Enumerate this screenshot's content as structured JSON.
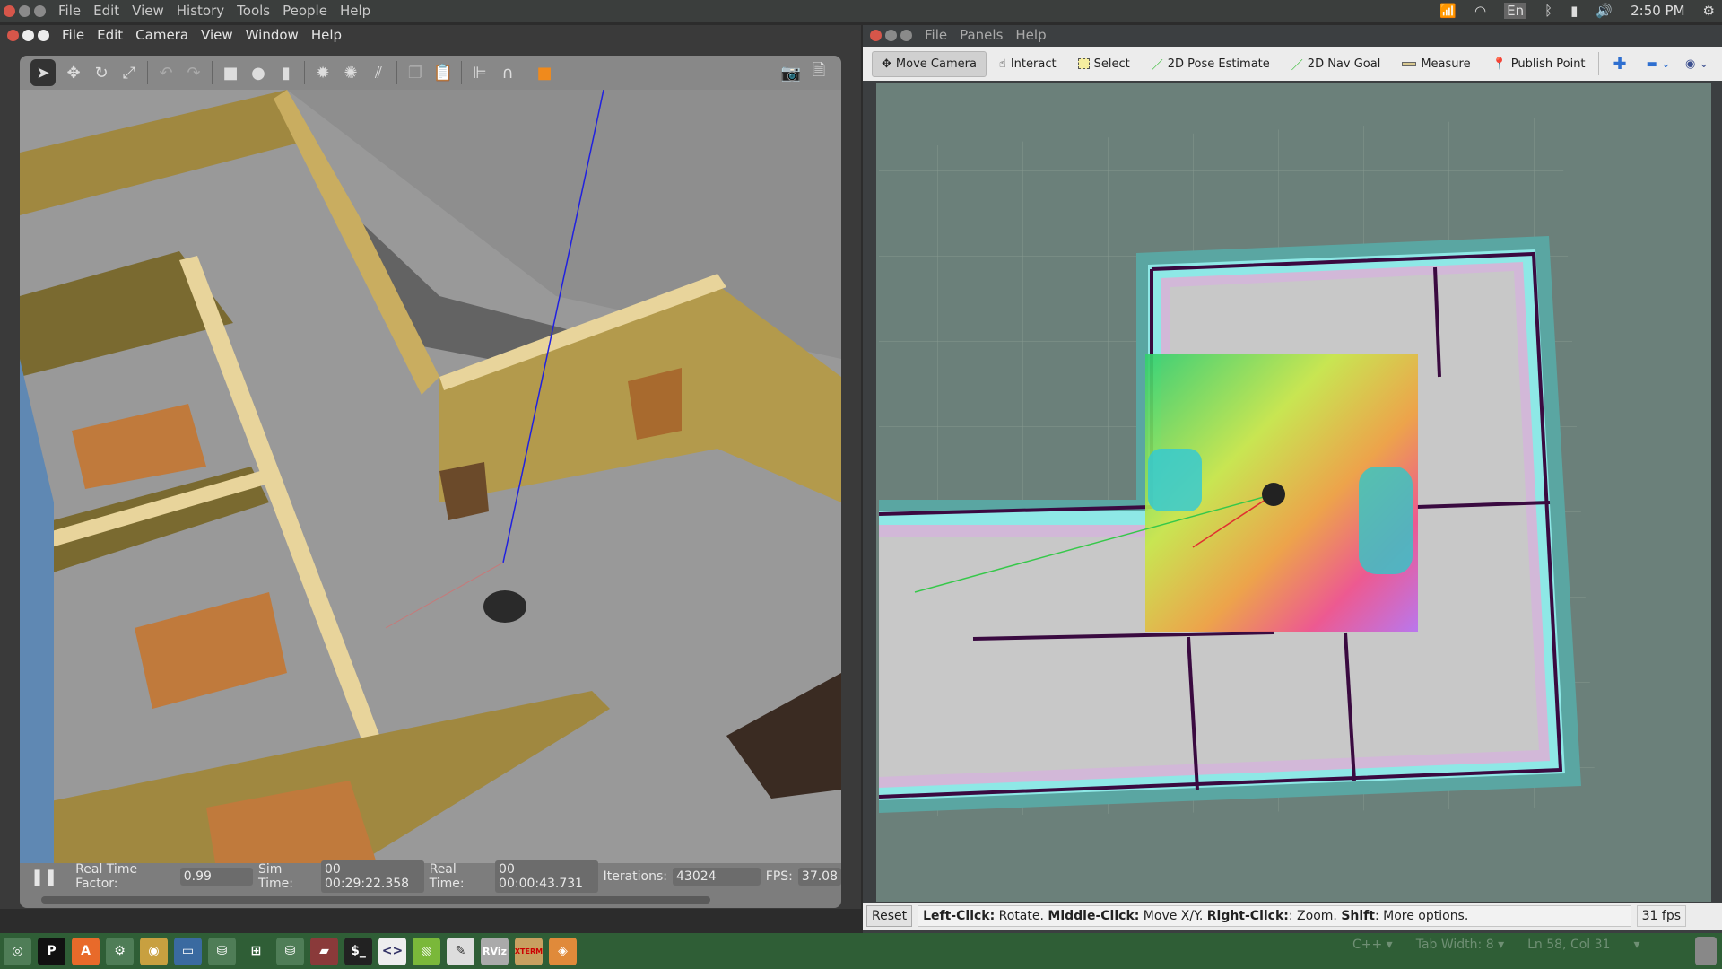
{
  "topbar": {
    "menus": [
      "File",
      "Edit",
      "View",
      "History",
      "Tools",
      "People",
      "Help"
    ],
    "keyboard": "En",
    "time": "2:50 PM"
  },
  "gazebo": {
    "menus": [
      "File",
      "Edit",
      "Camera",
      "View",
      "Window",
      "Help"
    ],
    "status": {
      "rtf_label": "Real Time Factor:",
      "rtf": "0.99",
      "sim_label": "Sim Time:",
      "sim": "00 00:29:22.358",
      "real_label": "Real Time:",
      "real": "00 00:00:43.731",
      "iter_label": "Iterations:",
      "iter": "43024",
      "fps_label": "FPS:",
      "fps": "37.08"
    }
  },
  "rviz": {
    "menus": [
      "File",
      "Panels",
      "Help"
    ],
    "tools": [
      "Move Camera",
      "Interact",
      "Select",
      "2D Pose Estimate",
      "2D Nav Goal",
      "Measure",
      "Publish Point"
    ],
    "reset": "Reset",
    "hint": {
      "b1": "Left-Click:",
      "t1": " Rotate. ",
      "b2": "Middle-Click:",
      "t2": " Move X/Y. ",
      "b3": "Right-Click:",
      "t3": ": Zoom. ",
      "b4": "Shift",
      "t4": ": More options."
    },
    "fps": "31 fps"
  },
  "dock": {
    "items": [
      "ubuntu",
      "P",
      "A",
      "settings",
      "chrome",
      "files",
      "drive",
      "workspace",
      "drive2",
      "folder",
      "$_",
      "<>",
      "image",
      "editor",
      "RViz",
      "XTERM",
      "gazebo"
    ]
  },
  "editor": {
    "lang": "C++ ▾",
    "tab": "Tab Width: 8 ▾",
    "pos": "Ln 58, Col 31",
    "arrow": "▾"
  }
}
